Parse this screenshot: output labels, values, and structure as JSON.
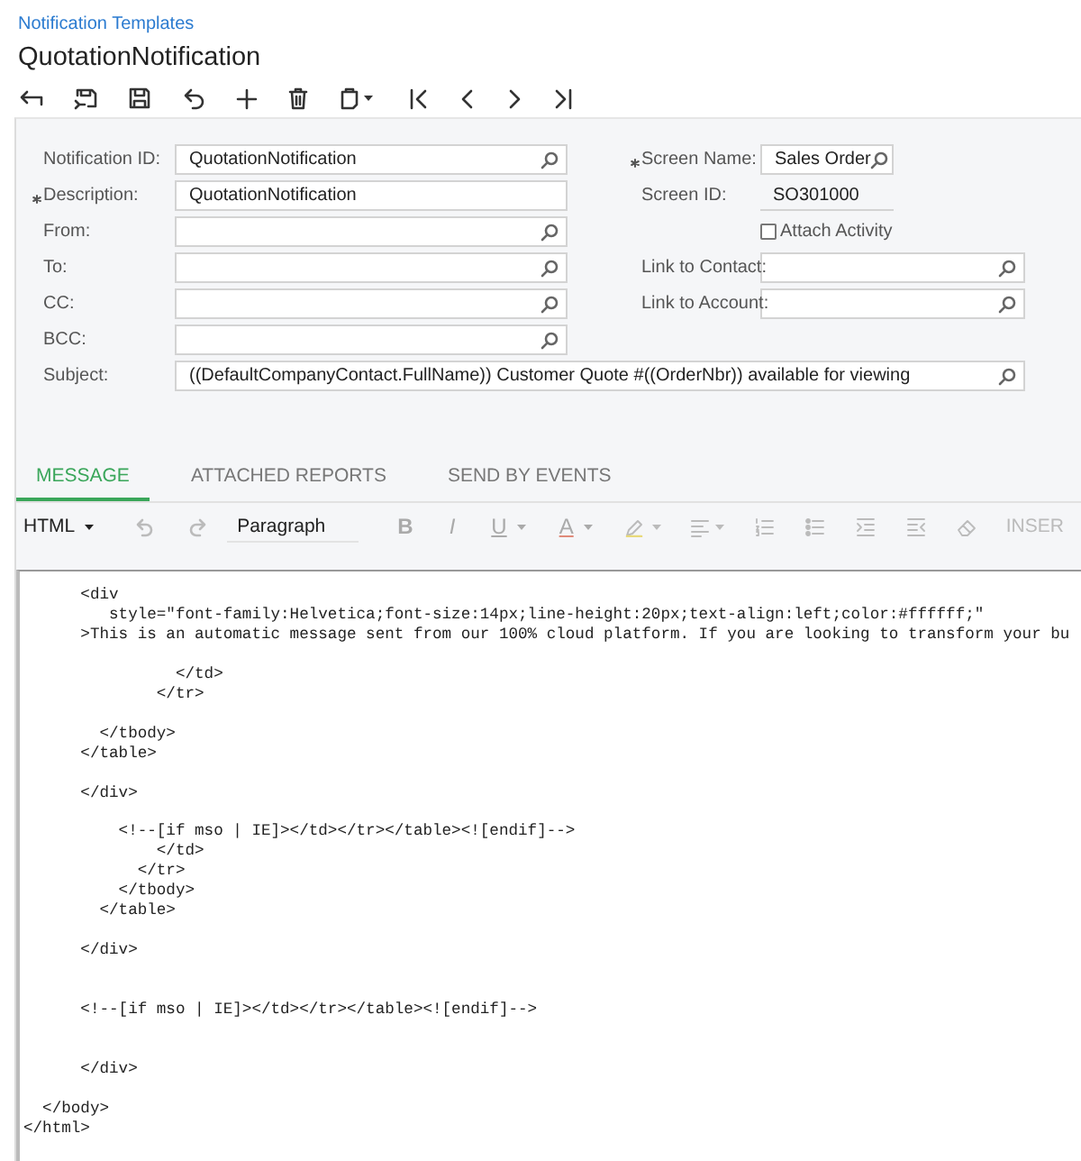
{
  "breadcrumb": "Notification Templates",
  "title": "QuotationNotification",
  "form": {
    "left": [
      {
        "label": "Notification ID:",
        "required": false,
        "kind": "lookup",
        "value": "QuotationNotification"
      },
      {
        "label": "Description:",
        "required": true,
        "kind": "text",
        "value": "QuotationNotification"
      },
      {
        "label": "From:",
        "required": false,
        "kind": "lookup"
      },
      {
        "label": "To:",
        "required": false,
        "kind": "lookup"
      },
      {
        "label": "CC:",
        "required": false,
        "kind": "lookup"
      },
      {
        "label": "BCC:",
        "required": false,
        "kind": "lookup"
      }
    ],
    "right": [
      {
        "label": "Screen Name:",
        "required": true,
        "kind": "lookup",
        "value": "Sales Order"
      },
      {
        "label": "Screen ID:",
        "required": false,
        "kind": "readonly",
        "value": "SO301000"
      },
      {
        "label": "Attach Activity",
        "kind": "checkbox",
        "checked": false
      },
      {
        "label": "Link to Contact:",
        "required": false,
        "kind": "lookup"
      },
      {
        "label": "Link to Account:",
        "required": false,
        "kind": "lookup"
      }
    ],
    "subject": {
      "label": "Subject:",
      "required": false,
      "kind": "lookup",
      "value": "((DefaultCompanyContact.FullName)) Customer Quote #((OrderNbr)) available for viewing"
    }
  },
  "tabs": [
    {
      "label": "MESSAGE",
      "selected": true
    },
    {
      "label": "ATTACHED REPORTS",
      "selected": false
    },
    {
      "label": "SEND BY EVENTS",
      "selected": false
    }
  ],
  "editor_toolbar": {
    "mode": "HTML",
    "block_format": "Paragraph",
    "letters": [
      {
        "label": "B",
        "caret": false
      },
      {
        "label": "I",
        "caret": false
      },
      {
        "label": "U",
        "caret": true
      },
      {
        "label": "A",
        "caret": true
      }
    ],
    "insert_label": "INSER"
  },
  "code": "      <div\n         style=\"font-family:Helvetica;font-size:14px;line-height:20px;text-align:left;color:#ffffff;\"\n      >This is an automatic message sent from our 100% cloud platform. If you are looking to transform your bu\n\n                </td>\n              </tr>\n\n        </tbody>\n      </table>\n\n      </div>\n\n          <!--[if mso | IE]></td></tr></table><![endif]-->\n              </td>\n            </tr>\n          </tbody>\n        </table>\n\n      </div>\n\n\n      <!--[if mso | IE]></td></tr></table><![endif]-->\n\n\n      </div>\n\n  </body>\n</html>"
}
